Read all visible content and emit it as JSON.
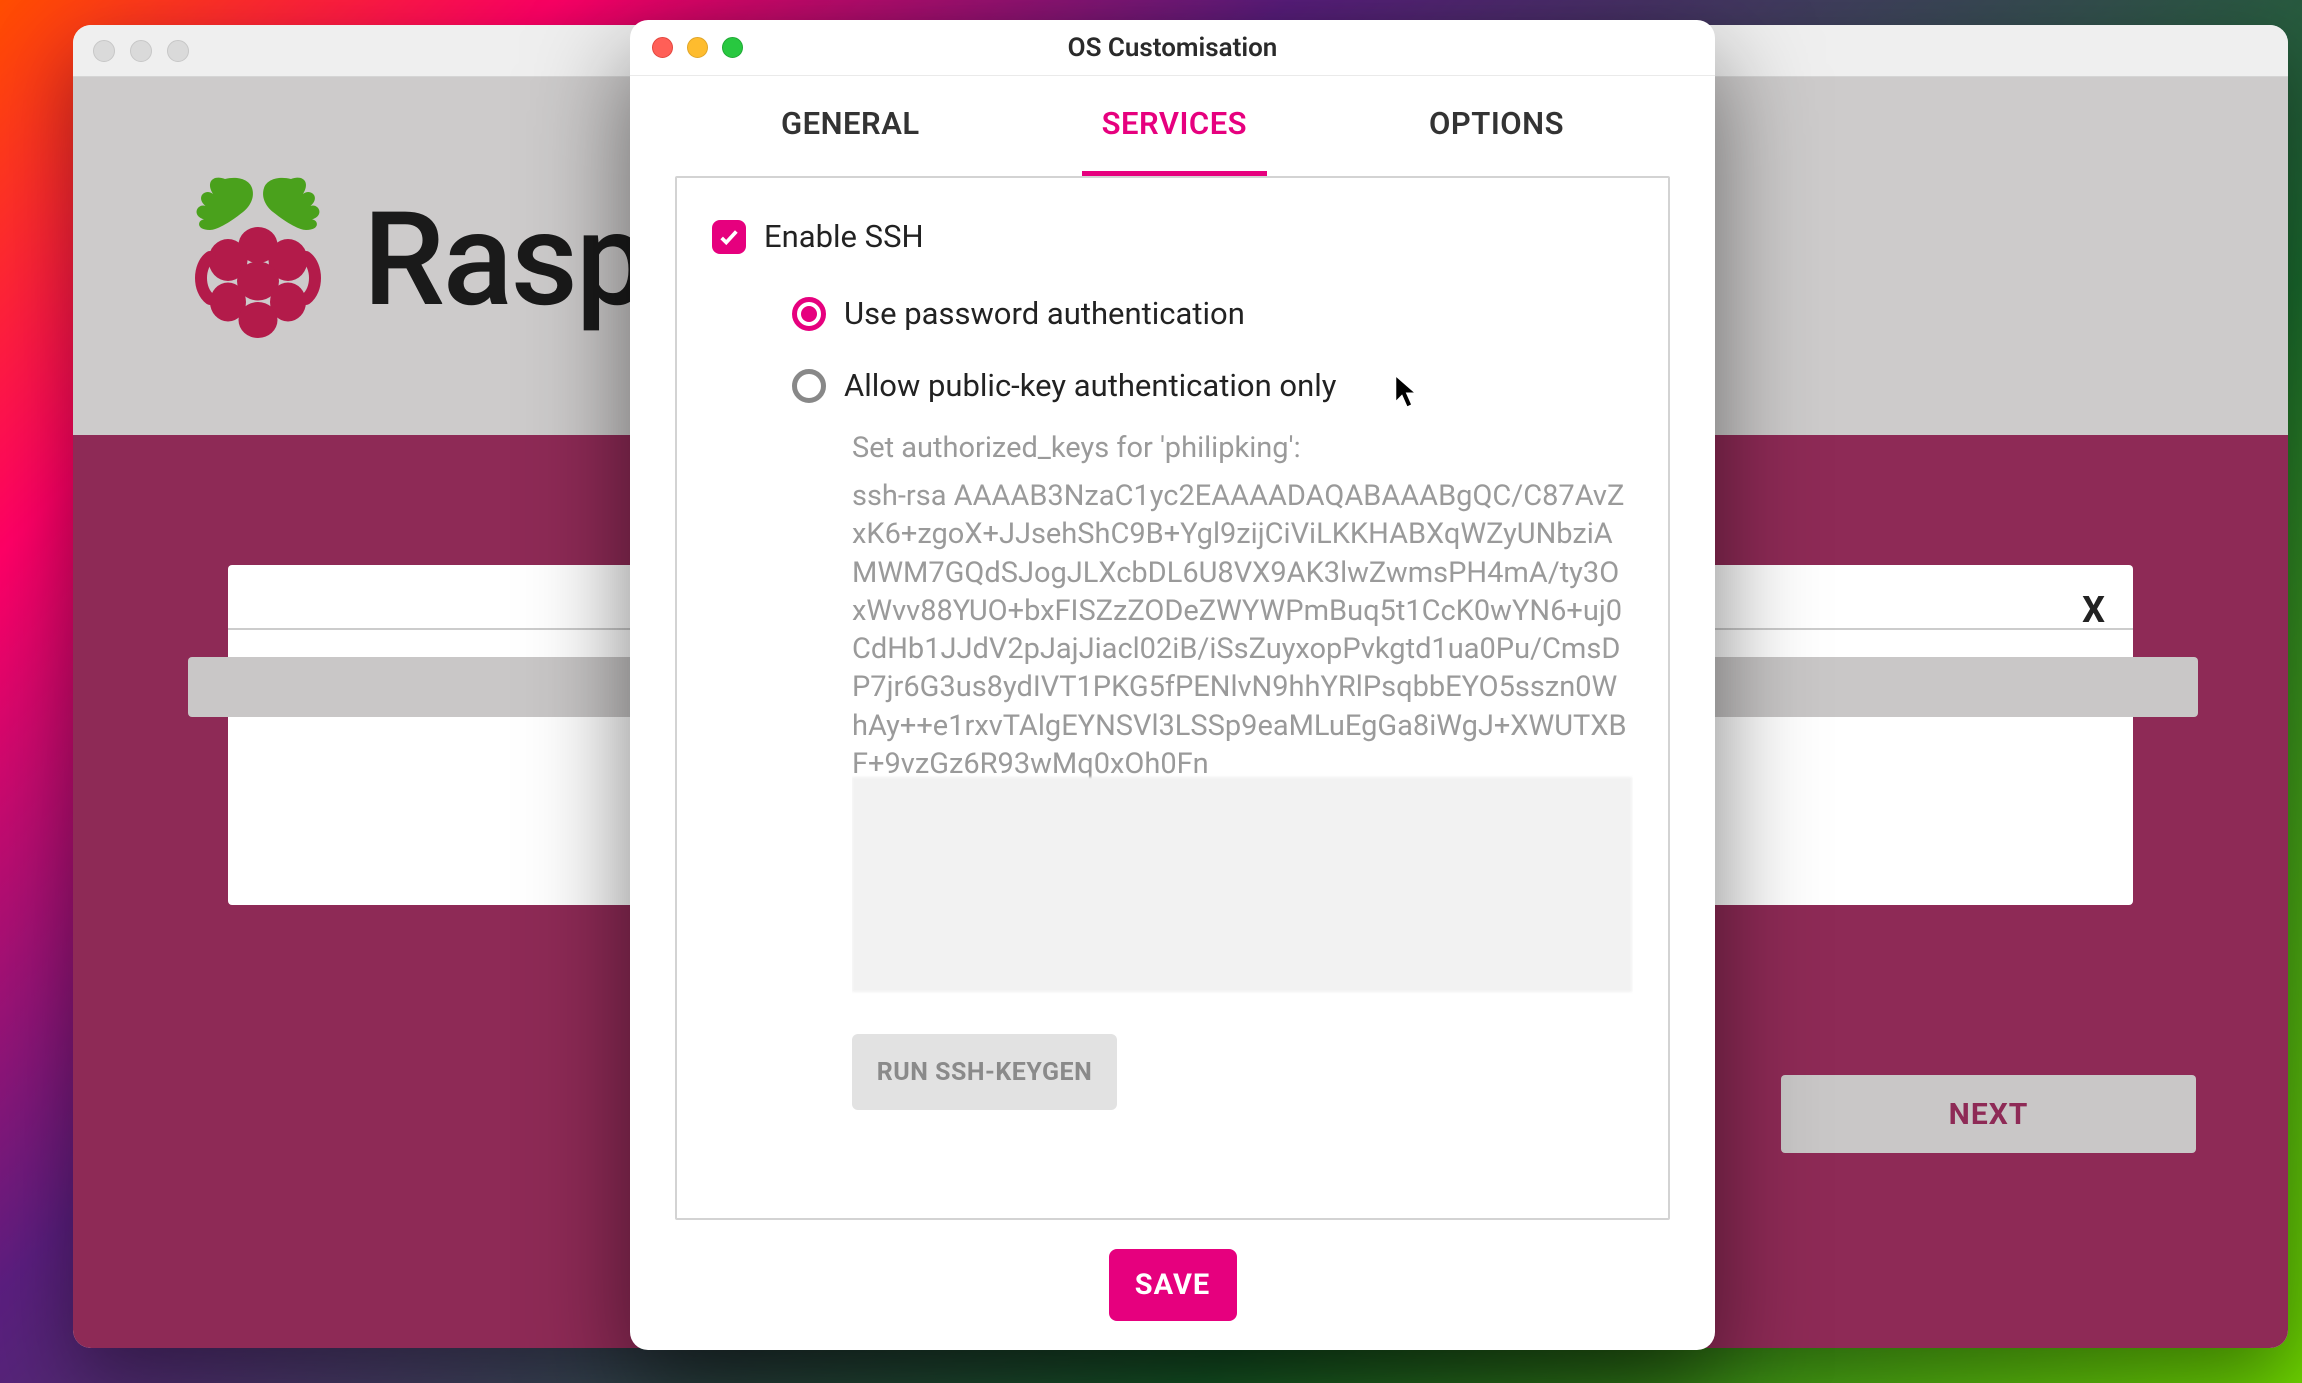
{
  "parent_window": {
    "app_name": "Rasp",
    "close_x": "X",
    "next_button": "NEXT"
  },
  "modal": {
    "title": "OS Customisation",
    "tabs": {
      "general": "GENERAL",
      "services": "SERVICES",
      "options": "OPTIONS"
    },
    "enable_ssh_label": "Enable SSH",
    "radio_password": "Use password authentication",
    "radio_pubkey": "Allow public-key authentication only",
    "authorized_keys_label": "Set authorized_keys for 'philipking':",
    "ssh_key": "ssh-rsa AAAAB3NzaC1yc2EAAAADAQABAAABgQC/C87AvZxK6+zgoX+JJsehShC9B+Ygl9zijCiViLKKHABXqWZyUNbziAMWM7GQdSJogJLXcbDL6U8VX9AK3lwZwmsPH4mA/ty3OxWvv88YUO+bxFISZzZODeZWYWPmBuq5t1CcK0wYN6+uj0CdHb1JJdV2pJajJiacl02iB/iSsZuyxopPvkgtd1ua0Pu/CmsDP7jr6G3us8ydIVT1PKG5fPENlvN9hhYRlPsqbbEYO5sszn0WhAy++e1rxvTAlgEYNSVl3LSSp9eaMLuEgGa8iWgJ+XWUTXBF+9vzGz6R93wMq0xOh0Fn",
    "keygen_button": "RUN SSH-KEYGEN",
    "save_button": "SAVE"
  },
  "colors": {
    "accent": "#e6007e",
    "parent_body": "#8e2a56"
  }
}
